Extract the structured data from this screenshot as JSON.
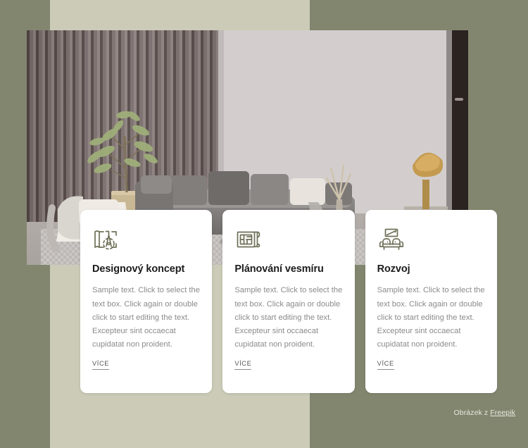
{
  "theme": {
    "outer_background": "#83866f",
    "panel_background": "#cbcbb8",
    "card_background": "#ffffff",
    "title_color": "#1c1c1c",
    "body_text_color": "#8b8b8b",
    "icon_color": "#6f7058",
    "link_color": "#555555"
  },
  "hero": {
    "alt": "Moderní obývací pokoj s šedou rohovou pohovkou, stromem v květináči a zlatou lampou"
  },
  "cards": [
    {
      "icon": "drafting-compass-icon",
      "title": "Designový koncept",
      "text": "Sample text. Click to select the text box. Click again or double click to start editing the text. Excepteur sint occaecat cupidatat non proident.",
      "more_label": "VÍCE"
    },
    {
      "icon": "floor-plan-icon",
      "title": "Plánování vesmíru",
      "text": "Sample text. Click to select the text box. Click again or double click to start editing the text. Excepteur sint occaecat cupidatat non proident.",
      "more_label": "VÍCE"
    },
    {
      "icon": "sofa-icon",
      "title": "Rozvoj",
      "text": "Sample text. Click to select the text box. Click again or double click to start editing the text. Excepteur sint occaecat cupidatat non proident.",
      "more_label": "VÍCE"
    }
  ],
  "credit": {
    "prefix": "Obrázek z ",
    "link_label": "Freepik"
  }
}
